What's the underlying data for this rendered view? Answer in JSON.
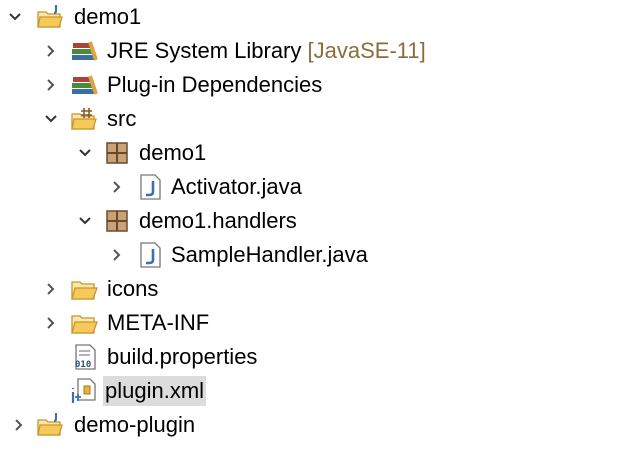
{
  "project_explorer": {
    "selected_item": "plugin.xml",
    "colors": {
      "decoration": "#8a6d3b",
      "selection": "#dcdcdc",
      "folder": "#e6b43c",
      "java": "#3a6fb7"
    },
    "items": [
      {
        "label": "demo1",
        "icon": "project-folder-icon",
        "expanded": true
      },
      {
        "label": "JRE System Library",
        "decoration": "[JavaSE-11]",
        "icon": "library-icon",
        "expanded": false
      },
      {
        "label": "Plug-in Dependencies",
        "icon": "library-icon",
        "expanded": false
      },
      {
        "label": "src",
        "icon": "source-folder-icon",
        "expanded": true
      },
      {
        "label": "demo1",
        "icon": "package-icon",
        "expanded": true
      },
      {
        "label": "Activator.java",
        "icon": "java-file-icon",
        "expanded": false
      },
      {
        "label": "demo1.handlers",
        "icon": "package-icon",
        "expanded": true
      },
      {
        "label": "SampleHandler.java",
        "icon": "java-file-icon",
        "expanded": false
      },
      {
        "label": "icons",
        "icon": "folder-icon",
        "expanded": false
      },
      {
        "label": "META-INF",
        "icon": "folder-icon",
        "expanded": false
      },
      {
        "label": "build.properties",
        "icon": "properties-file-icon"
      },
      {
        "label": "plugin.xml",
        "icon": "plugin-xml-icon",
        "selected": true
      },
      {
        "label": "demo-plugin",
        "icon": "project-folder-icon",
        "expanded": false
      }
    ]
  }
}
